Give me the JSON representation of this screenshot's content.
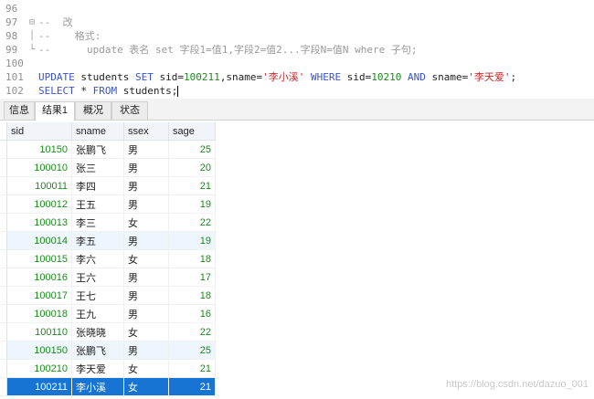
{
  "editor": {
    "lines": [
      {
        "num": "96",
        "fold": "",
        "segments": []
      },
      {
        "num": "97",
        "fold": "⊟",
        "segments": [
          {
            "t": "--  改",
            "c": "cmt"
          }
        ]
      },
      {
        "num": "98",
        "fold": "│",
        "segments": [
          {
            "t": "--    格式:",
            "c": "cmt"
          }
        ]
      },
      {
        "num": "99",
        "fold": "└",
        "segments": [
          {
            "t": "--      update 表名 set 字段1=值1,字段2=值2...字段N=值N where 子句;",
            "c": "cmt"
          }
        ]
      },
      {
        "num": "100",
        "fold": "",
        "segments": []
      },
      {
        "num": "101",
        "fold": "",
        "segments": [
          {
            "t": "UPDATE",
            "c": "kw"
          },
          {
            "t": " students ",
            "c": "plain"
          },
          {
            "t": "SET",
            "c": "kw"
          },
          {
            "t": " sid=",
            "c": "plain"
          },
          {
            "t": "100211",
            "c": "num"
          },
          {
            "t": ",sname=",
            "c": "plain"
          },
          {
            "t": "'李小溪'",
            "c": "str"
          },
          {
            "t": " ",
            "c": "plain"
          },
          {
            "t": "WHERE",
            "c": "kw"
          },
          {
            "t": " sid=",
            "c": "plain"
          },
          {
            "t": "10210",
            "c": "num"
          },
          {
            "t": " ",
            "c": "plain"
          },
          {
            "t": "AND",
            "c": "kw"
          },
          {
            "t": " sname=",
            "c": "plain"
          },
          {
            "t": "'李天爱'",
            "c": "str"
          },
          {
            "t": ";",
            "c": "plain"
          }
        ]
      },
      {
        "num": "102",
        "fold": "",
        "segments": [
          {
            "t": "SELECT",
            "c": "kw"
          },
          {
            "t": " * ",
            "c": "plain"
          },
          {
            "t": "FROM",
            "c": "kw"
          },
          {
            "t": " students;",
            "c": "plain"
          }
        ],
        "cursor": true
      }
    ]
  },
  "tabs": [
    {
      "label": "信息",
      "active": false
    },
    {
      "label": "结果1",
      "active": true
    },
    {
      "label": "概况",
      "active": false
    },
    {
      "label": "状态",
      "active": false
    }
  ],
  "table": {
    "columns": [
      "sid",
      "sname",
      "ssex",
      "sage"
    ],
    "rows": [
      [
        "10150",
        "张鹏飞",
        "男",
        "25"
      ],
      [
        "100010",
        "张三",
        "男",
        "20"
      ],
      [
        "100011",
        "李四",
        "男",
        "21"
      ],
      [
        "100012",
        "王五",
        "男",
        "19"
      ],
      [
        "100013",
        "李三",
        "女",
        "22"
      ],
      [
        "100014",
        "李五",
        "男",
        "19"
      ],
      [
        "100015",
        "李六",
        "女",
        "18"
      ],
      [
        "100016",
        "王六",
        "男",
        "17"
      ],
      [
        "100017",
        "王七",
        "男",
        "18"
      ],
      [
        "100018",
        "王九",
        "男",
        "16"
      ],
      [
        "100110",
        "张晓晓",
        "女",
        "22"
      ],
      [
        "100150",
        "张鹏飞",
        "男",
        "25"
      ],
      [
        "100210",
        "李天爱",
        "女",
        "21"
      ],
      [
        "100211",
        "李小溪",
        "女",
        "21"
      ]
    ],
    "selected_row": 13,
    "alt_rows": [
      5,
      11
    ]
  },
  "watermark": "https://blog.csdn.net/dazuo_001"
}
